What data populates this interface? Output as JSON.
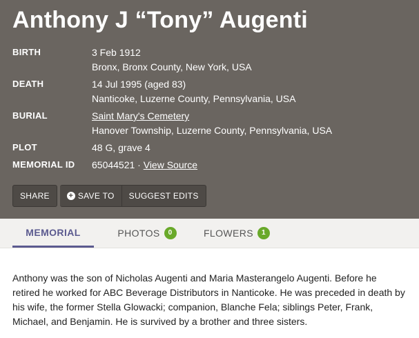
{
  "memorial": {
    "name": "Anthony J “Tony” Augenti",
    "birth": {
      "label": "BIRTH",
      "date": "3 Feb 1912",
      "place": "Bronx, Bronx County, New York, USA"
    },
    "death": {
      "label": "DEATH",
      "date": "14 Jul 1995 (aged 83)",
      "place": "Nanticoke, Luzerne County, Pennsylvania, USA"
    },
    "burial": {
      "label": "BURIAL",
      "cemetery": "Saint Mary's Cemetery",
      "place": "Hanover Township, Luzerne County, Pennsylvania, USA"
    },
    "plot": {
      "label": "PLOT",
      "value": "48 G, grave 4"
    },
    "memorial_id": {
      "label": "MEMORIAL ID",
      "value": "65044521 · ",
      "link": "View Source"
    }
  },
  "actions": {
    "share": "SHARE",
    "save_to": "SAVE TO",
    "suggest_edits": "SUGGEST EDITS",
    "save_icon": "plus-circle-icon"
  },
  "tabs": [
    {
      "label": "MEMORIAL"
    },
    {
      "label": "PHOTOS",
      "count": "0"
    },
    {
      "label": "FLOWERS",
      "count": "1"
    }
  ],
  "bio": "Anthony was the son of Nicholas Augenti and Maria Masterangelo Augenti. Before he retired he worked for ABC Beverage Distributors in Nanticoke. He was preceded in death by his wife, the former Stella Glowacki; companion, Blanche Fela; siblings Peter, Frank, Michael, and Benjamin. He is survived by a brother and three sisters.",
  "colors": {
    "header_bg": "#6a6560",
    "active_tab": "#5b5a8f",
    "badge": "#69a92a"
  }
}
